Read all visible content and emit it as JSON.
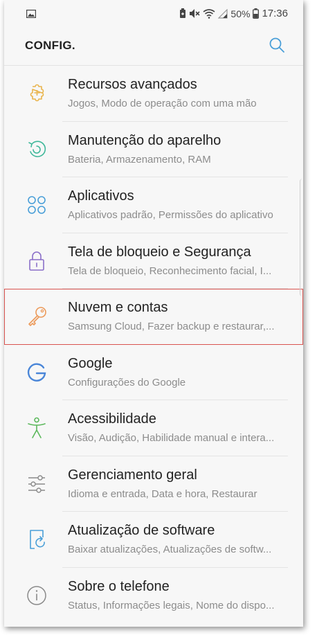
{
  "statusbar": {
    "battery": "50%",
    "time": "17:36",
    "icons": [
      "image-icon",
      "battery-saver-icon",
      "mute-icon",
      "wifi-icon",
      "signal-icon",
      "battery-icon"
    ]
  },
  "appbar": {
    "title": "CONFIG.",
    "search_icon": "search-icon"
  },
  "items": [
    {
      "name": "recursos",
      "icon": "puzzle-plus-icon",
      "color": "#e9b44c",
      "title": "Recursos avançados",
      "subtitle": "Jogos, Modo de operação com uma mão"
    },
    {
      "name": "manutencao",
      "icon": "maintenance-icon",
      "color": "#3fb89a",
      "title": "Manutenção do aparelho",
      "subtitle": "Bateria, Armazenamento, RAM"
    },
    {
      "name": "aplicativos",
      "icon": "apps-grid-icon",
      "color": "#4a9fd8",
      "title": "Aplicativos",
      "subtitle": "Aplicativos padrão, Permissões do aplicativo"
    },
    {
      "name": "tela-bloqueio",
      "icon": "lock-icon",
      "color": "#8a6fc8",
      "title": "Tela de bloqueio e Segurança",
      "subtitle": "Tela de bloqueio, Reconhecimento facial, I..."
    },
    {
      "name": "nuvem",
      "icon": "key-icon",
      "color": "#ec9a5a",
      "title": "Nuvem e contas",
      "subtitle": "Samsung Cloud, Fazer backup e restaurar,..."
    },
    {
      "name": "google",
      "icon": "google-icon",
      "color": "#4a86d8",
      "title": "Google",
      "subtitle": "Configurações do Google"
    },
    {
      "name": "acessibilidade",
      "icon": "accessibility-icon",
      "color": "#5cb85c",
      "title": "Acessibilidade",
      "subtitle": "Visão, Audição, Habilidade manual e intera..."
    },
    {
      "name": "gerenciamento",
      "icon": "sliders-icon",
      "color": "#8a8a8a",
      "title": "Gerenciamento geral",
      "subtitle": "Idioma e entrada, Data e hora, Restaurar"
    },
    {
      "name": "atualizacao",
      "icon": "software-update-icon",
      "color": "#4a9fd8",
      "title": "Atualização de software",
      "subtitle": "Baixar atualizações, Atualizações de softw..."
    },
    {
      "name": "sobre",
      "icon": "info-icon",
      "color": "#8a8a8a",
      "title": "Sobre o telefone",
      "subtitle": "Status, Informações legais, Nome do dispo..."
    }
  ]
}
